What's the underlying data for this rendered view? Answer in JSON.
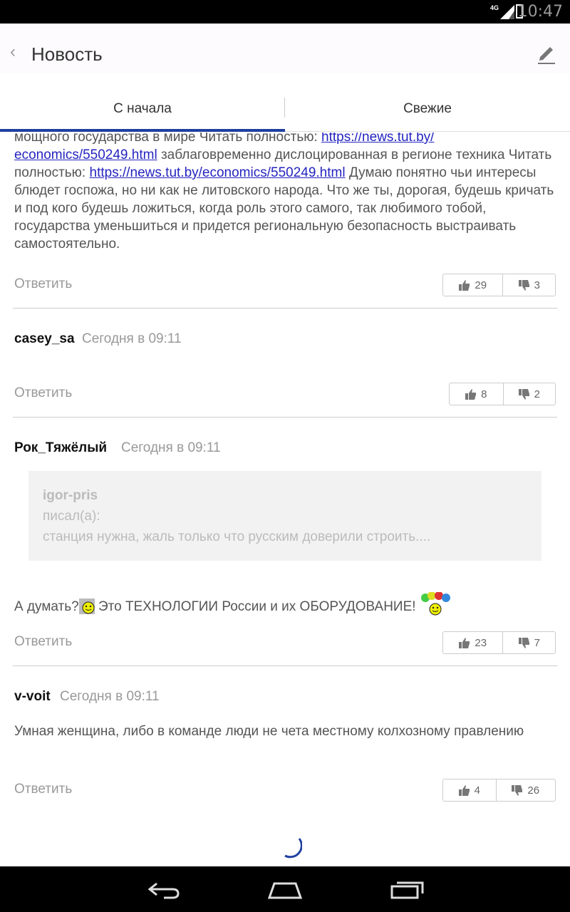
{
  "status": {
    "time": "10:47",
    "network": "4G"
  },
  "appbar": {
    "back_glyph": "‹",
    "title": "Новость",
    "edit_icon": "pencil-icon"
  },
  "tabs": [
    {
      "label": "С начала"
    },
    {
      "label": "Свежие"
    }
  ],
  "comments": [
    {
      "text_parts": [
        "мощного государства в мире Читать полностью: ",
        "https://news.tut.by/",
        "economics/550249.html",
        " заблаговременно дислоцированная в регионе техника Читать полностью: ",
        "https://news.tut.by/economics/550249.html",
        " Думаю понятно чьи интересы блюдет госпожа, но ни как не литовского народа. Что же ты, дорогая, будешь кричать и под кого будешь ложиться, когда роль этого самого, так любимого тобой, государства уменьшиться и придется региональную безопасность выстраивать самостоятельно."
      ],
      "reply": "Ответить",
      "likes": "29",
      "dislikes": "3"
    },
    {
      "author": "casey_sa",
      "time": "Сегодня в 09:11",
      "reply": "Ответить",
      "likes": "8",
      "dislikes": "2"
    },
    {
      "author": "Рок_Тяжёлый",
      "time": "Сегодня в 09:11",
      "quote": {
        "author": "igor-pris",
        "wrote": "писал(а):",
        "text": "станция нужна, жаль только что русским доверили строить...."
      },
      "text_a": "А думать?",
      "text_b": " Это ТЕХНОЛОГИИ России и их ОБОРУДОВАНИЕ!",
      "reply": "Ответить",
      "likes": "23",
      "dislikes": "7"
    },
    {
      "author": "v-voit",
      "time": "Сегодня в 09:11",
      "text": "Умная женщина, либо в команде люди не чета местному колхозному правлению",
      "reply": "Ответить",
      "likes": "4",
      "dislikes": "26"
    }
  ],
  "colors": {
    "accent": "#2040a0",
    "link": "#2424c0"
  }
}
